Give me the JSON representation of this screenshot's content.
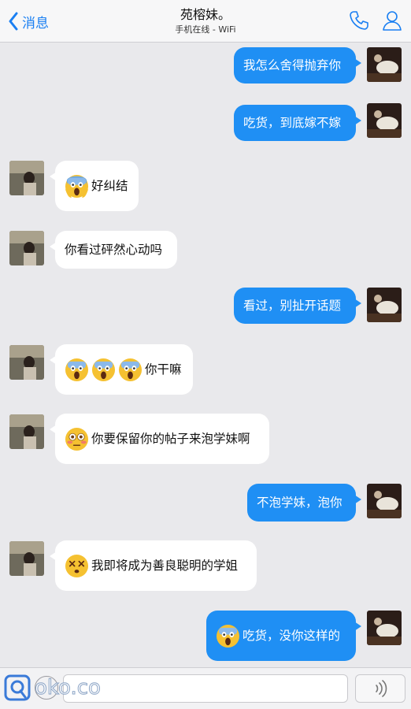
{
  "nav": {
    "back_label": "消息",
    "title": "苑榕妹。",
    "subtitle": "手机在线 - WiFi"
  },
  "colors": {
    "outgoing_bubble": "#1f8ff4",
    "incoming_bubble": "#ffffff",
    "background": "#e9e9ec",
    "accent": "#1a7ff2"
  },
  "messages": [
    {
      "side": "outgoing",
      "text": "我怎么舍得抛弃你",
      "emojis": []
    },
    {
      "side": "outgoing",
      "text": "吃货，到底嫁不嫁",
      "emojis": []
    },
    {
      "side": "incoming",
      "text": "好纠结",
      "emojis": [
        "scream-emoji"
      ]
    },
    {
      "side": "incoming",
      "text": "你看过砰然心动吗",
      "emojis": []
    },
    {
      "side": "outgoing",
      "text": "看过，别扯开话题",
      "emojis": []
    },
    {
      "side": "incoming",
      "text": "你干嘛",
      "emojis": [
        "scream-emoji",
        "scream-emoji",
        "scream-emoji"
      ]
    },
    {
      "side": "incoming",
      "text": "你要保留你的帖子来泡学妹啊",
      "emojis": [
        "flushed-emoji"
      ]
    },
    {
      "side": "outgoing",
      "text": "不泡学妹，泡你",
      "emojis": []
    },
    {
      "side": "incoming",
      "text": "我即将成为善良聪明的学姐",
      "emojis": [
        "dizzy-face-emoji"
      ]
    },
    {
      "side": "outgoing",
      "text": "吃货，没你这样的",
      "emojis": [
        "scream-emoji"
      ]
    }
  ],
  "input": {
    "value": "",
    "placeholder": ""
  },
  "icons": {
    "back": "chevron-left-icon",
    "call": "phone-icon",
    "profile": "person-icon",
    "voice": "voice-wave-icon",
    "plus": "plus-circle-icon"
  },
  "watermark": "oko.co"
}
